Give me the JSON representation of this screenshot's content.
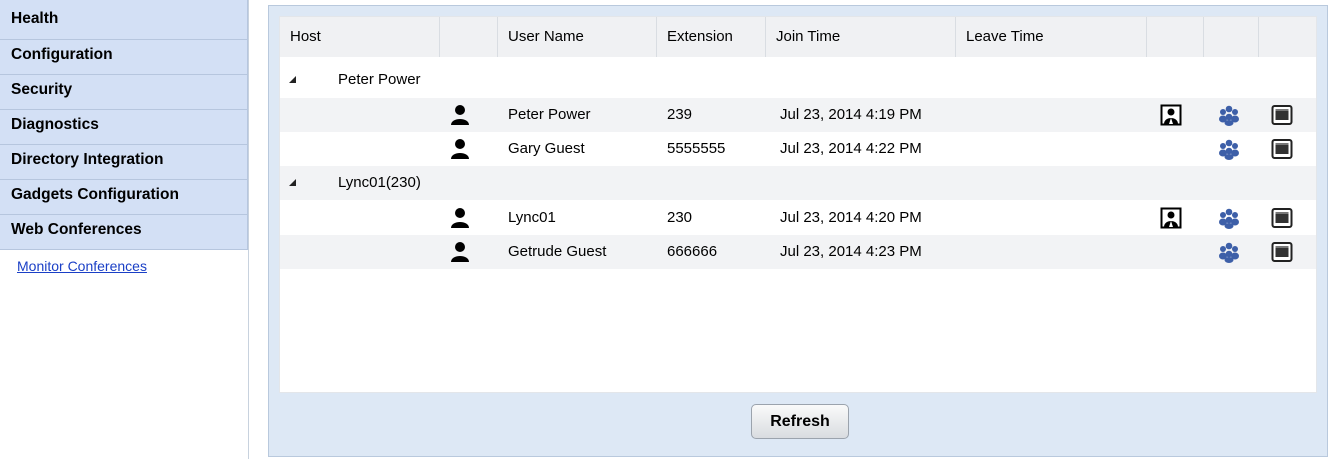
{
  "sidebar": {
    "items": [
      {
        "label": "Health"
      },
      {
        "label": "Configuration"
      },
      {
        "label": "Security"
      },
      {
        "label": "Diagnostics"
      },
      {
        "label": "Directory Integration"
      },
      {
        "label": "Gadgets Configuration"
      },
      {
        "label": "Web Conferences"
      }
    ],
    "sub_link": "Monitor Conferences"
  },
  "grid": {
    "columns": [
      "Host",
      "",
      "User Name",
      "Extension",
      "Join Time",
      "Leave Time",
      "",
      "",
      ""
    ],
    "groups": [
      {
        "host": "Peter Power",
        "participants": [
          {
            "user_name": "Peter Power",
            "extension": "239",
            "join_time": "Jul 23, 2014 4:19 PM",
            "leave_time": "",
            "presenter": true
          },
          {
            "user_name": "Gary Guest",
            "extension": "5555555",
            "join_time": "Jul 23, 2014 4:22 PM",
            "leave_time": "",
            "presenter": false
          }
        ]
      },
      {
        "host": "Lync01(230)",
        "participants": [
          {
            "user_name": "Lync01",
            "extension": "230",
            "join_time": "Jul 23, 2014 4:20 PM",
            "leave_time": "",
            "presenter": true
          },
          {
            "user_name": "Getrude Guest",
            "extension": "666666",
            "join_time": "Jul 23, 2014 4:23 PM",
            "leave_time": "",
            "presenter": false
          }
        ]
      }
    ]
  },
  "refresh_label": "Refresh",
  "icons": {
    "user": "user-icon",
    "presenter": "presenter-icon",
    "attendees": "attendees-icon",
    "screen_share": "screen-share-icon"
  },
  "colors": {
    "nav_bg": "#d3e0f5",
    "panel_bg": "#dde8f5",
    "link": "#1a3fc6",
    "attendees_icon": "#3d5fa8"
  }
}
